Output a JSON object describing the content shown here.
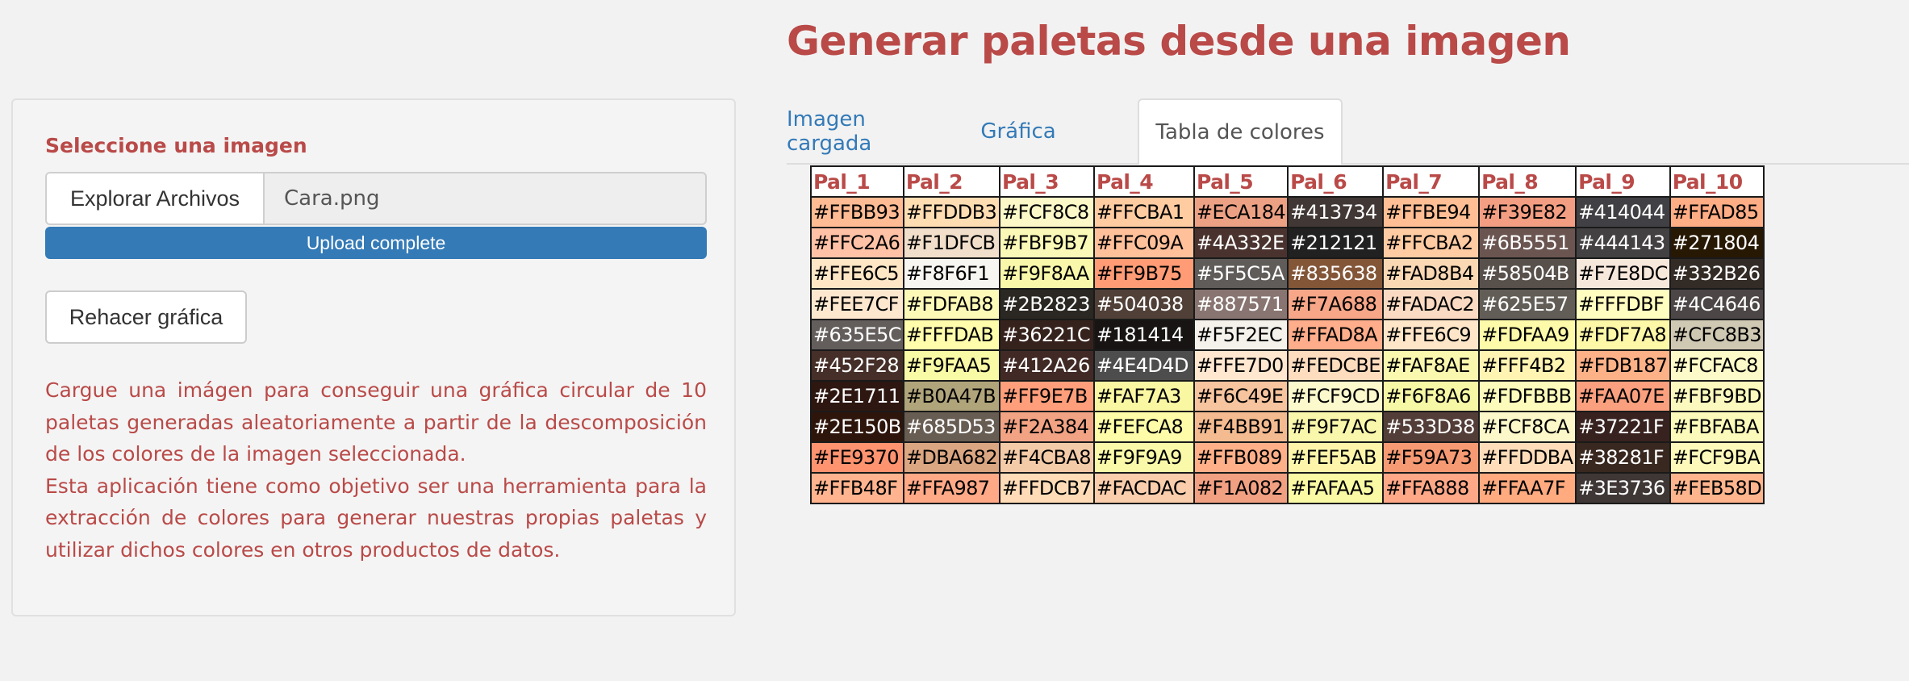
{
  "title": "Generar paletas desde una imagen",
  "sidebar": {
    "input_label": "Seleccione una imagen",
    "browse_button": "Explorar Archivos",
    "file_name": "Cara.png",
    "upload_status": "Upload complete",
    "progress": 1.0,
    "redo_button": "Rehacer gráfica",
    "description": [
      "Cargue una imágen para conseguir una gráfica circular de 10 paletas generadas aleatoriamente a partir de la descomposición de los colores de la imagen seleccionada.",
      "Esta aplicación tiene como objetivo ser una herramienta para la extracción de colores para generar nuestras propias paletas y utilizar dichos colores en otros productos de datos."
    ]
  },
  "tabs": [
    {
      "label": "Imagen cargada",
      "active": false
    },
    {
      "label": "Gráfica",
      "active": false
    },
    {
      "label": "Tabla de colores",
      "active": true
    }
  ],
  "table": {
    "headers": [
      "Pal_1",
      "Pal_2",
      "Pal_3",
      "Pal_4",
      "Pal_5",
      "Pal_6",
      "Pal_7",
      "Pal_8",
      "Pal_9",
      "Pal_10"
    ],
    "rows": [
      [
        "#FFBB93",
        "#FFDDB3",
        "#FCF8C8",
        "#FFCBA1",
        "#ECA184",
        "#413734",
        "#FFBE94",
        "#F39E82",
        "#414044",
        "#FFAD85"
      ],
      [
        "#FFC2A6",
        "#F1DFCB",
        "#FBF9B7",
        "#FFC09A",
        "#4A332E",
        "#212121",
        "#FFCBA2",
        "#6B5551",
        "#444143",
        "#271804"
      ],
      [
        "#FFE6C5",
        "#F8F6F1",
        "#F9F8AA",
        "#FF9B75",
        "#5F5C5A",
        "#835638",
        "#FAD8B4",
        "#58504B",
        "#F7E8DC",
        "#332B26"
      ],
      [
        "#FEE7CF",
        "#FDFAB8",
        "#2B2823",
        "#504038",
        "#887571",
        "#F7A688",
        "#FADAC2",
        "#625E57",
        "#FFFDBF",
        "#4C4646"
      ],
      [
        "#635E5C",
        "#FFFDAB",
        "#36221C",
        "#181414",
        "#F5F2EC",
        "#FFAD8A",
        "#FFE6C9",
        "#FDFAA9",
        "#FDF7A8",
        "#CFC8B3"
      ],
      [
        "#452F28",
        "#F9FAA5",
        "#412A26",
        "#4E4D4D",
        "#FFE7D0",
        "#FEDCBE",
        "#FAF8AE",
        "#FFF4B2",
        "#FDB187",
        "#FCFAC8"
      ],
      [
        "#2E1711",
        "#B0A47B",
        "#FF9E7B",
        "#FAF7A3",
        "#F6C49E",
        "#FCF9CD",
        "#F6F8A6",
        "#FDFBBB",
        "#FAA07E",
        "#FBF9BD"
      ],
      [
        "#2E150B",
        "#685D53",
        "#F2A384",
        "#FEFCA8",
        "#F4BB91",
        "#F9F7AC",
        "#533D38",
        "#FCF8CA",
        "#37221F",
        "#FBFABA"
      ],
      [
        "#FE9370",
        "#DBA682",
        "#F4CBA8",
        "#F9F9A9",
        "#FFB089",
        "#FEF5AB",
        "#F59A73",
        "#FFDDBA",
        "#38281F",
        "#FCF9BA"
      ],
      [
        "#FFB48F",
        "#FFA987",
        "#FFDCB7",
        "#FACDAC",
        "#F1A082",
        "#FAFAA5",
        "#FFA888",
        "#FFAA7F",
        "#3E3736",
        "#FEB58D"
      ]
    ]
  }
}
